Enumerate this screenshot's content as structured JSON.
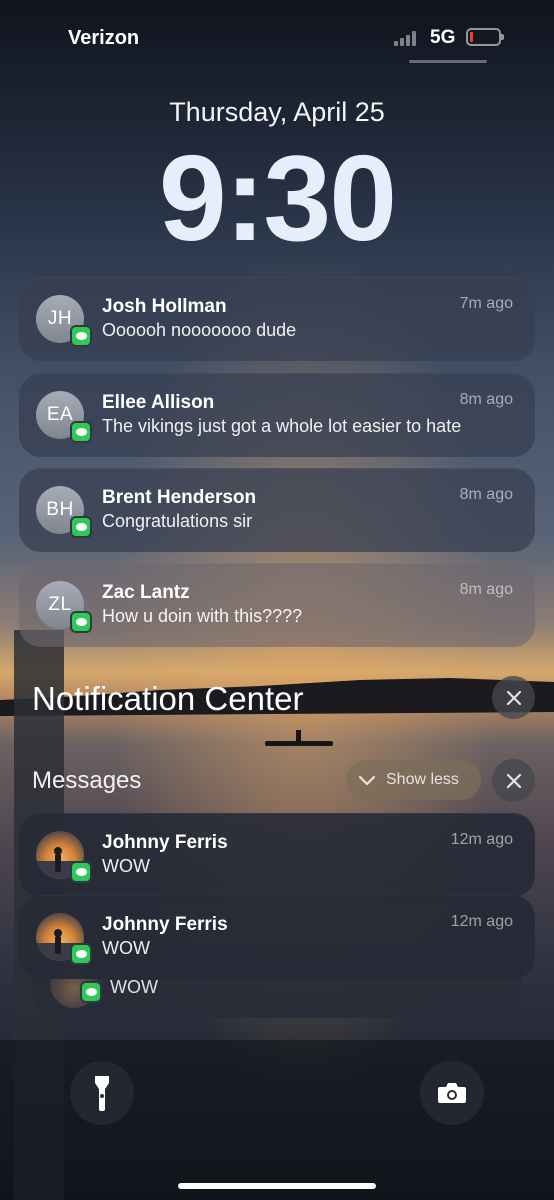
{
  "status_bar": {
    "carrier": "Verizon",
    "network": "5G",
    "battery_color": "#ff3b30"
  },
  "lock": {
    "date": "Thursday, April 25",
    "time": "9:30"
  },
  "notifications": [
    {
      "initials": "JH",
      "sender": "Josh Hollman",
      "body": "Oooooh nooooooo dude",
      "ago": "7m ago",
      "app_icon": "messages-icon"
    },
    {
      "initials": "EA",
      "sender": "Ellee Allison",
      "body": "The vikings just got a whole lot easier to hate",
      "ago": "8m ago",
      "app_icon": "messages-icon"
    },
    {
      "initials": "BH",
      "sender": "Brent Henderson",
      "body": "Congratulations sir",
      "ago": "8m ago",
      "app_icon": "messages-icon"
    },
    {
      "initials": "ZL",
      "sender": "Zac Lantz",
      "body": "How u doin with this????",
      "ago": "8m ago",
      "app_icon": "messages-icon"
    }
  ],
  "notification_center": {
    "title": "Notification Center",
    "group_label": "Messages",
    "show_less_label": "Show less",
    "grouped": [
      {
        "sender": "Johnny Ferris",
        "body": "WOW",
        "ago": "12m ago"
      },
      {
        "sender": "Johnny Ferris",
        "body": "WOW",
        "ago": "12m ago"
      }
    ],
    "stacked_preview": {
      "body": "WOW"
    }
  },
  "bottom_controls": {
    "left_icon": "flashlight-icon",
    "right_icon": "camera-icon"
  },
  "colors": {
    "messages_green": "#32c759"
  }
}
